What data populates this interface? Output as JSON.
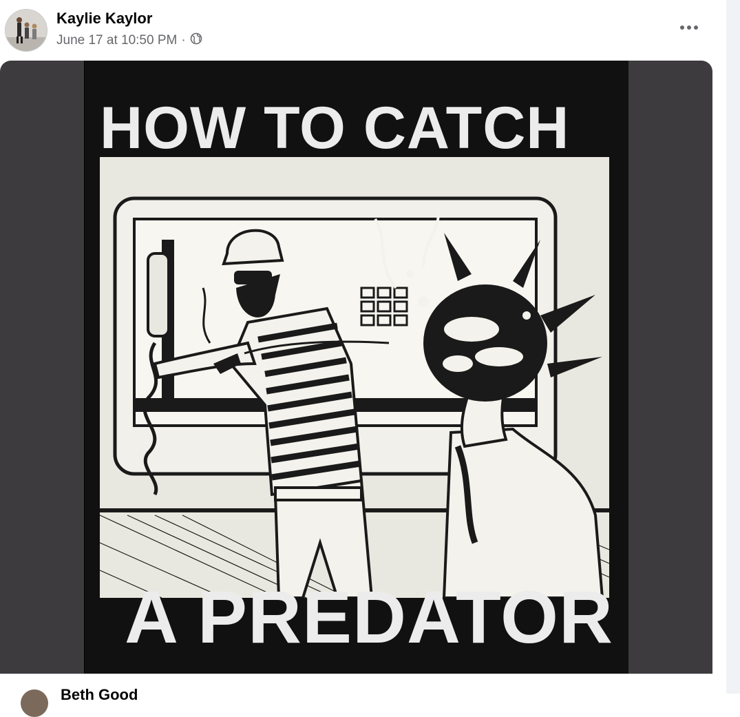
{
  "post": {
    "author": "Kaylie Kaylor",
    "timestamp": "June 17 at 10:50 PM",
    "separator": "·",
    "audience_icon": "globe-icon",
    "more_icon": "more-horizontal-icon"
  },
  "image": {
    "headline_top": "HOW TO CATCH",
    "headline_bottom": "A PREDATOR"
  },
  "next_comment": {
    "author": "Beth Good"
  },
  "colors": {
    "media_background": "#3d3b3e",
    "shirt": "#111111",
    "print_ink": "#ececec",
    "name_text": "#050505",
    "meta_text": "#65676b"
  }
}
